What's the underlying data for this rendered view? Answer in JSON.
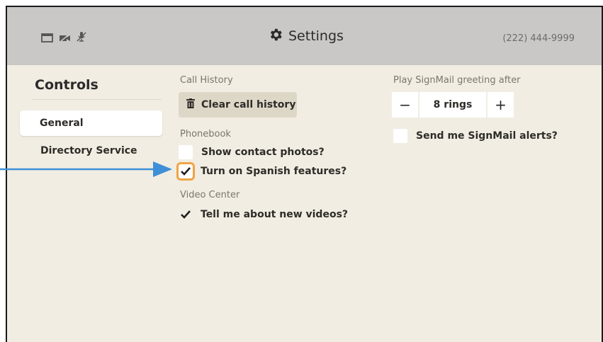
{
  "header": {
    "status_icons": [
      "screen-icon",
      "video-off-icon",
      "mic-off-icon"
    ],
    "title": "Settings",
    "title_icon": "gear-icon",
    "phone": "(222) 444-9999"
  },
  "sidebar": {
    "title": "Controls",
    "items": [
      {
        "label": "General",
        "selected": true
      },
      {
        "label": "Directory Service",
        "selected": false
      }
    ]
  },
  "call_history": {
    "label": "Call History",
    "clear_button": "Clear call history",
    "clear_icon": "trash-icon"
  },
  "phonebook": {
    "label": "Phonebook",
    "show_photos": {
      "label": "Show contact photos?",
      "checked": false
    },
    "spanish": {
      "label": "Turn on Spanish features?",
      "checked": true,
      "focused": true
    }
  },
  "video_center": {
    "label": "Video Center",
    "new_videos": {
      "label": "Tell me about new videos?",
      "checked": true
    }
  },
  "signmail": {
    "label": "Play SignMail greeting after",
    "minus": "−",
    "value": "8 rings",
    "plus": "+",
    "alerts": {
      "label": "Send me SignMail alerts?",
      "checked": false
    }
  },
  "colors": {
    "background": "#f1ede2",
    "topbar": "#c9c8c6",
    "focus": "#f0a445",
    "annotation_arrow": "#3f8fd8"
  }
}
